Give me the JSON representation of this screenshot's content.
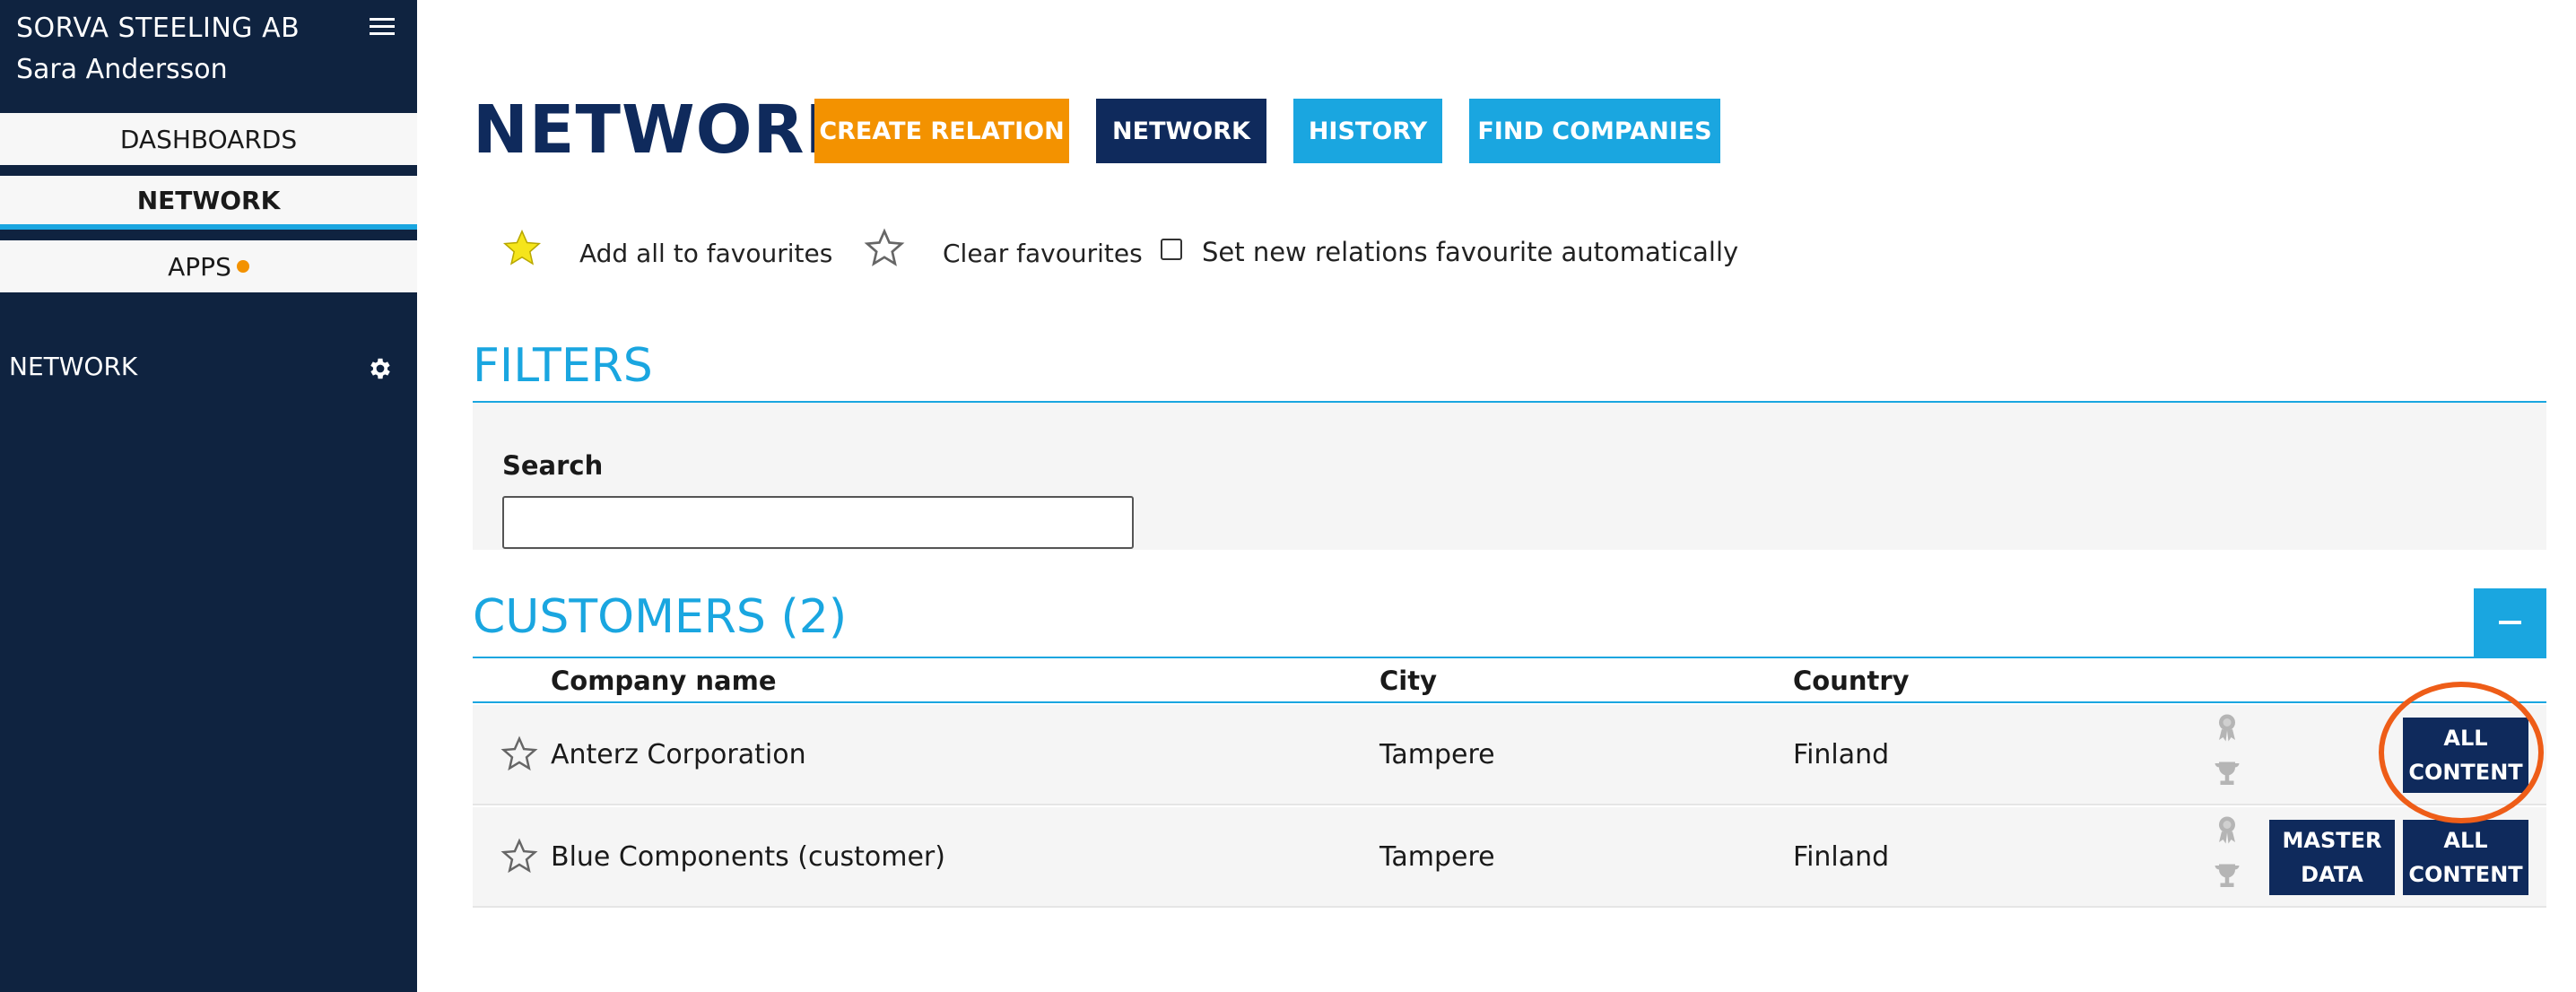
{
  "sidebar": {
    "company": "SORVA STEELING AB",
    "user": "Sara Andersson",
    "nav": {
      "dashboards": "DASHBOARDS",
      "network": "NETWORK",
      "apps": "APPS"
    },
    "section": "NETWORK"
  },
  "page": {
    "title": "NETWORK",
    "buttons": {
      "create": "CREATE RELATION",
      "network": "NETWORK",
      "history": "HISTORY",
      "find": "FIND COMPANIES"
    }
  },
  "favourites": {
    "add_all": "Add all to favourites",
    "clear": "Clear favourites",
    "auto_label": "Set new relations favourite automatically"
  },
  "filters": {
    "title": "FILTERS",
    "search_label": "Search",
    "search_value": ""
  },
  "customers": {
    "title": "CUSTOMERS (2)",
    "columns": {
      "name": "Company name",
      "city": "City",
      "country": "Country"
    },
    "rows": [
      {
        "name": "Anterz Corporation",
        "city": "Tampere",
        "country": "Finland",
        "all_content_1": "ALL",
        "all_content_2": "CONTENT"
      },
      {
        "name": "Blue Components (customer)",
        "city": "Tampere",
        "country": "Finland",
        "master_1": "MASTER",
        "master_2": "DATA",
        "all_content_1": "ALL",
        "all_content_2": "CONTENT"
      }
    ]
  },
  "colors": {
    "navy": "#0f2a5c",
    "sidebar": "#0f2340",
    "accent_blue": "#1aa6e0",
    "orange": "#f39200",
    "highlight": "#ee5d18",
    "star_yellow": "#f5e51b"
  }
}
